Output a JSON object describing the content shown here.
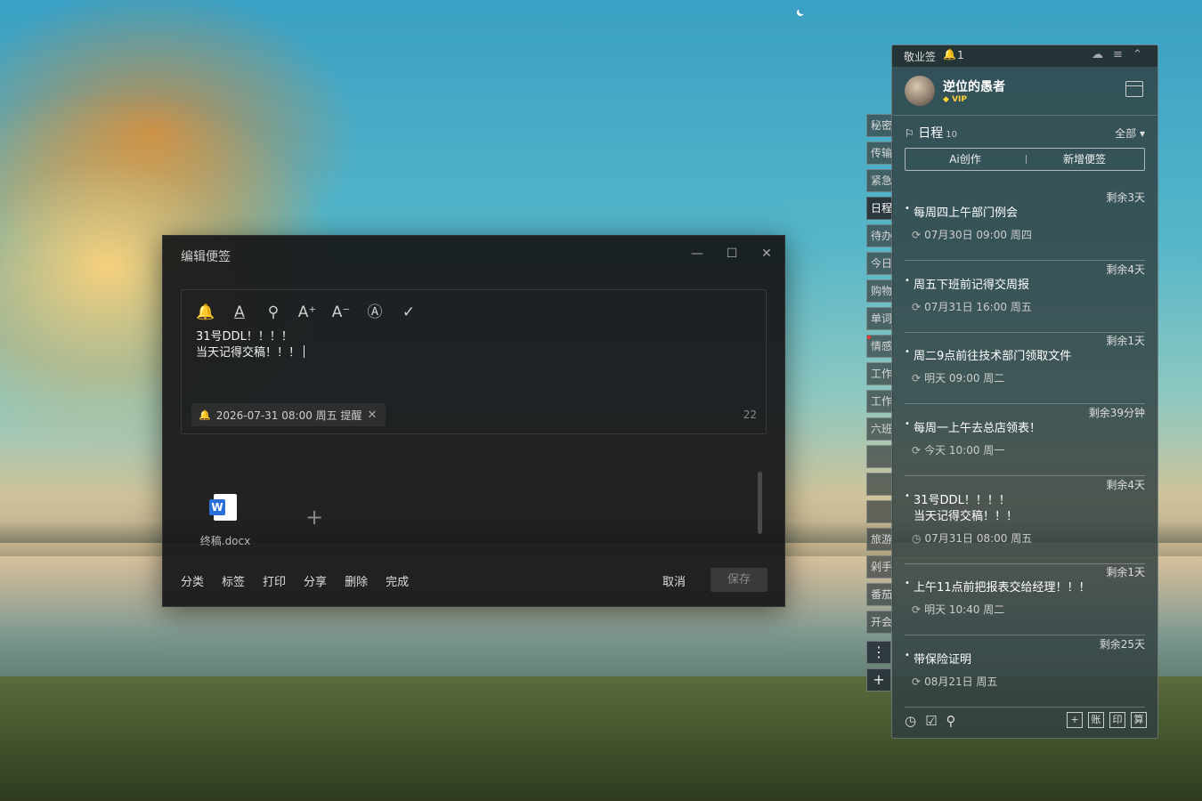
{
  "editor": {
    "title": "编辑便签",
    "window_controls": {
      "minimize": "—",
      "maximize": "☐",
      "close": "✕"
    },
    "toolbar_icons": [
      "bell-icon",
      "font-color-icon",
      "search-icon",
      "font-increase-icon",
      "font-decrease-icon",
      "clear-format-icon",
      "check-icon"
    ],
    "toolbar_glyphs": [
      "🔔",
      "A",
      "⚲",
      "A⁺",
      "A⁻",
      "Ⓐ",
      "✓"
    ],
    "note_line1": "31号DDL！！！！",
    "note_line2": "当天记得交稿！！！",
    "reminder": {
      "icon": "🔔",
      "text": "2026-07-31 08:00 周五 提醒",
      "close": "✕"
    },
    "char_count": "22",
    "attachment": {
      "icon_letter": "W",
      "name": "终稿.docx"
    },
    "add_attachment": "+",
    "actions": [
      "分类",
      "标签",
      "打印",
      "分享",
      "删除",
      "完成"
    ],
    "cancel_label": "取消",
    "save_label": "保存"
  },
  "side_tabs": [
    "秘密",
    "传输",
    "紧急",
    "日程",
    "待办",
    "今日",
    "购物",
    "单词",
    "情感",
    "工作",
    "工作",
    "六班",
    "",
    "",
    "",
    "旅游",
    "剁手",
    "番茄",
    "开会"
  ],
  "side_buttons": {
    "more": "⋮",
    "add": "+"
  },
  "panel": {
    "app_name": "敬业签",
    "bell_icon": "🔔",
    "bell_count": "1",
    "user": {
      "name": "逆位的愚者",
      "badge": "VIP"
    },
    "schedule": {
      "label": "日程",
      "count": "10",
      "filter": "全部 ▾"
    },
    "buttons": {
      "ai": "Ai创作",
      "new": "新增便签"
    },
    "items": [
      {
        "remain": "剩余3天",
        "title": "每周四上午部门例会",
        "meta": "07月30日 09:00 周四"
      },
      {
        "remain": "剩余4天",
        "title": "周五下班前记得交周报",
        "meta": "07月31日 16:00 周五"
      },
      {
        "remain": "剩余1天",
        "title": "周二9点前往技术部门领取文件",
        "meta": "明天 09:00 周二"
      },
      {
        "remain": "剩余39分钟",
        "title": "每周一上午去总店领表！",
        "meta": "今天 10:00 周一"
      },
      {
        "remain": "剩余4天",
        "title": "31号DDL！！！！\n当天记得交稿！！！",
        "meta": "07月31日 08:00 周五"
      },
      {
        "remain": "剩余1天",
        "title": "上午11点前把报表交给经理！！！",
        "meta": "明天 10:40 周二"
      },
      {
        "remain": "剩余25天",
        "title": "带保险证明",
        "meta": "08月21日 周五"
      }
    ],
    "footer_right": [
      "+",
      "账",
      "印",
      "算"
    ]
  }
}
